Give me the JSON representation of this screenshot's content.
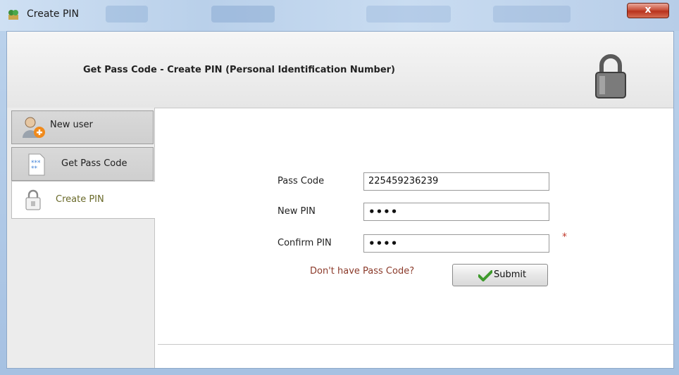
{
  "window": {
    "title": "Create PIN",
    "close_glyph": "x"
  },
  "header": {
    "title": "Get Pass Code - Create PIN (Personal Identification Number)",
    "icon": "padlock-icon"
  },
  "sidebar": {
    "items": [
      {
        "label": "New user",
        "icon": "add-user-icon",
        "active": false
      },
      {
        "label": "Get Pass Code",
        "icon": "passcode-document-icon",
        "active": false
      },
      {
        "label": "Create PIN",
        "icon": "lock-icon",
        "active": true
      }
    ]
  },
  "form": {
    "pass_code": {
      "label": "Pass Code",
      "value": "225459236239"
    },
    "new_pin": {
      "label": "New PIN",
      "value": "••••"
    },
    "confirm_pin": {
      "label": "Confirm PIN",
      "value": "••••",
      "required_mark": "*"
    },
    "help_link": "Don't have Pass Code?",
    "submit_label": "Submit",
    "submit_icon": "checkmark-icon"
  },
  "colors": {
    "active_nav_text": "#6a6a2a",
    "link": "#8b3a2a",
    "required": "#c0392b",
    "check": "#3f9a2d"
  }
}
